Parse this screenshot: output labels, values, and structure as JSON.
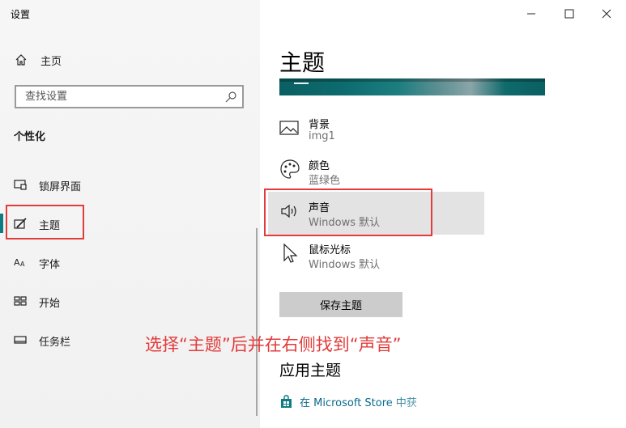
{
  "window": {
    "title": "设置",
    "minimize_icon": "minimize-icon",
    "maximize_icon": "maximize-icon",
    "close_icon": "close-icon"
  },
  "sidebar": {
    "home": {
      "label": "主页",
      "icon": "home-icon"
    },
    "search": {
      "placeholder": "查找设置",
      "icon": "search-icon"
    },
    "section_heading": "个性化",
    "items": [
      {
        "label": "锁屏界面",
        "icon": "lock-screen-icon",
        "active": false
      },
      {
        "label": "主题",
        "icon": "theme-brush-icon",
        "active": true
      },
      {
        "label": "字体",
        "icon": "font-icon",
        "active": false
      },
      {
        "label": "开始",
        "icon": "start-grid-icon",
        "active": false
      },
      {
        "label": "任务栏",
        "icon": "taskbar-icon",
        "active": false
      }
    ]
  },
  "main": {
    "title": "主题",
    "settings": [
      {
        "title": "背景",
        "value": "img1",
        "icon": "picture-icon"
      },
      {
        "title": "颜色",
        "value": "蓝绿色",
        "icon": "palette-icon"
      },
      {
        "title": "声音",
        "value": "Windows 默认",
        "icon": "speaker-icon"
      },
      {
        "title": "鼠标光标",
        "value": "Windows 默认",
        "icon": "cursor-icon"
      }
    ],
    "save_button": "保存主题",
    "apply_heading": "应用主题",
    "store_link": "在 Microsoft Store 中获",
    "store_icon": "store-bag-icon"
  },
  "annotation": {
    "text": "选择“主题”后并在右侧找到“声音”",
    "color": "#e23b3b"
  },
  "colors": {
    "accent": "#0f7b83",
    "annotation_red": "#e23b3b",
    "link": "#0a6a8a"
  }
}
